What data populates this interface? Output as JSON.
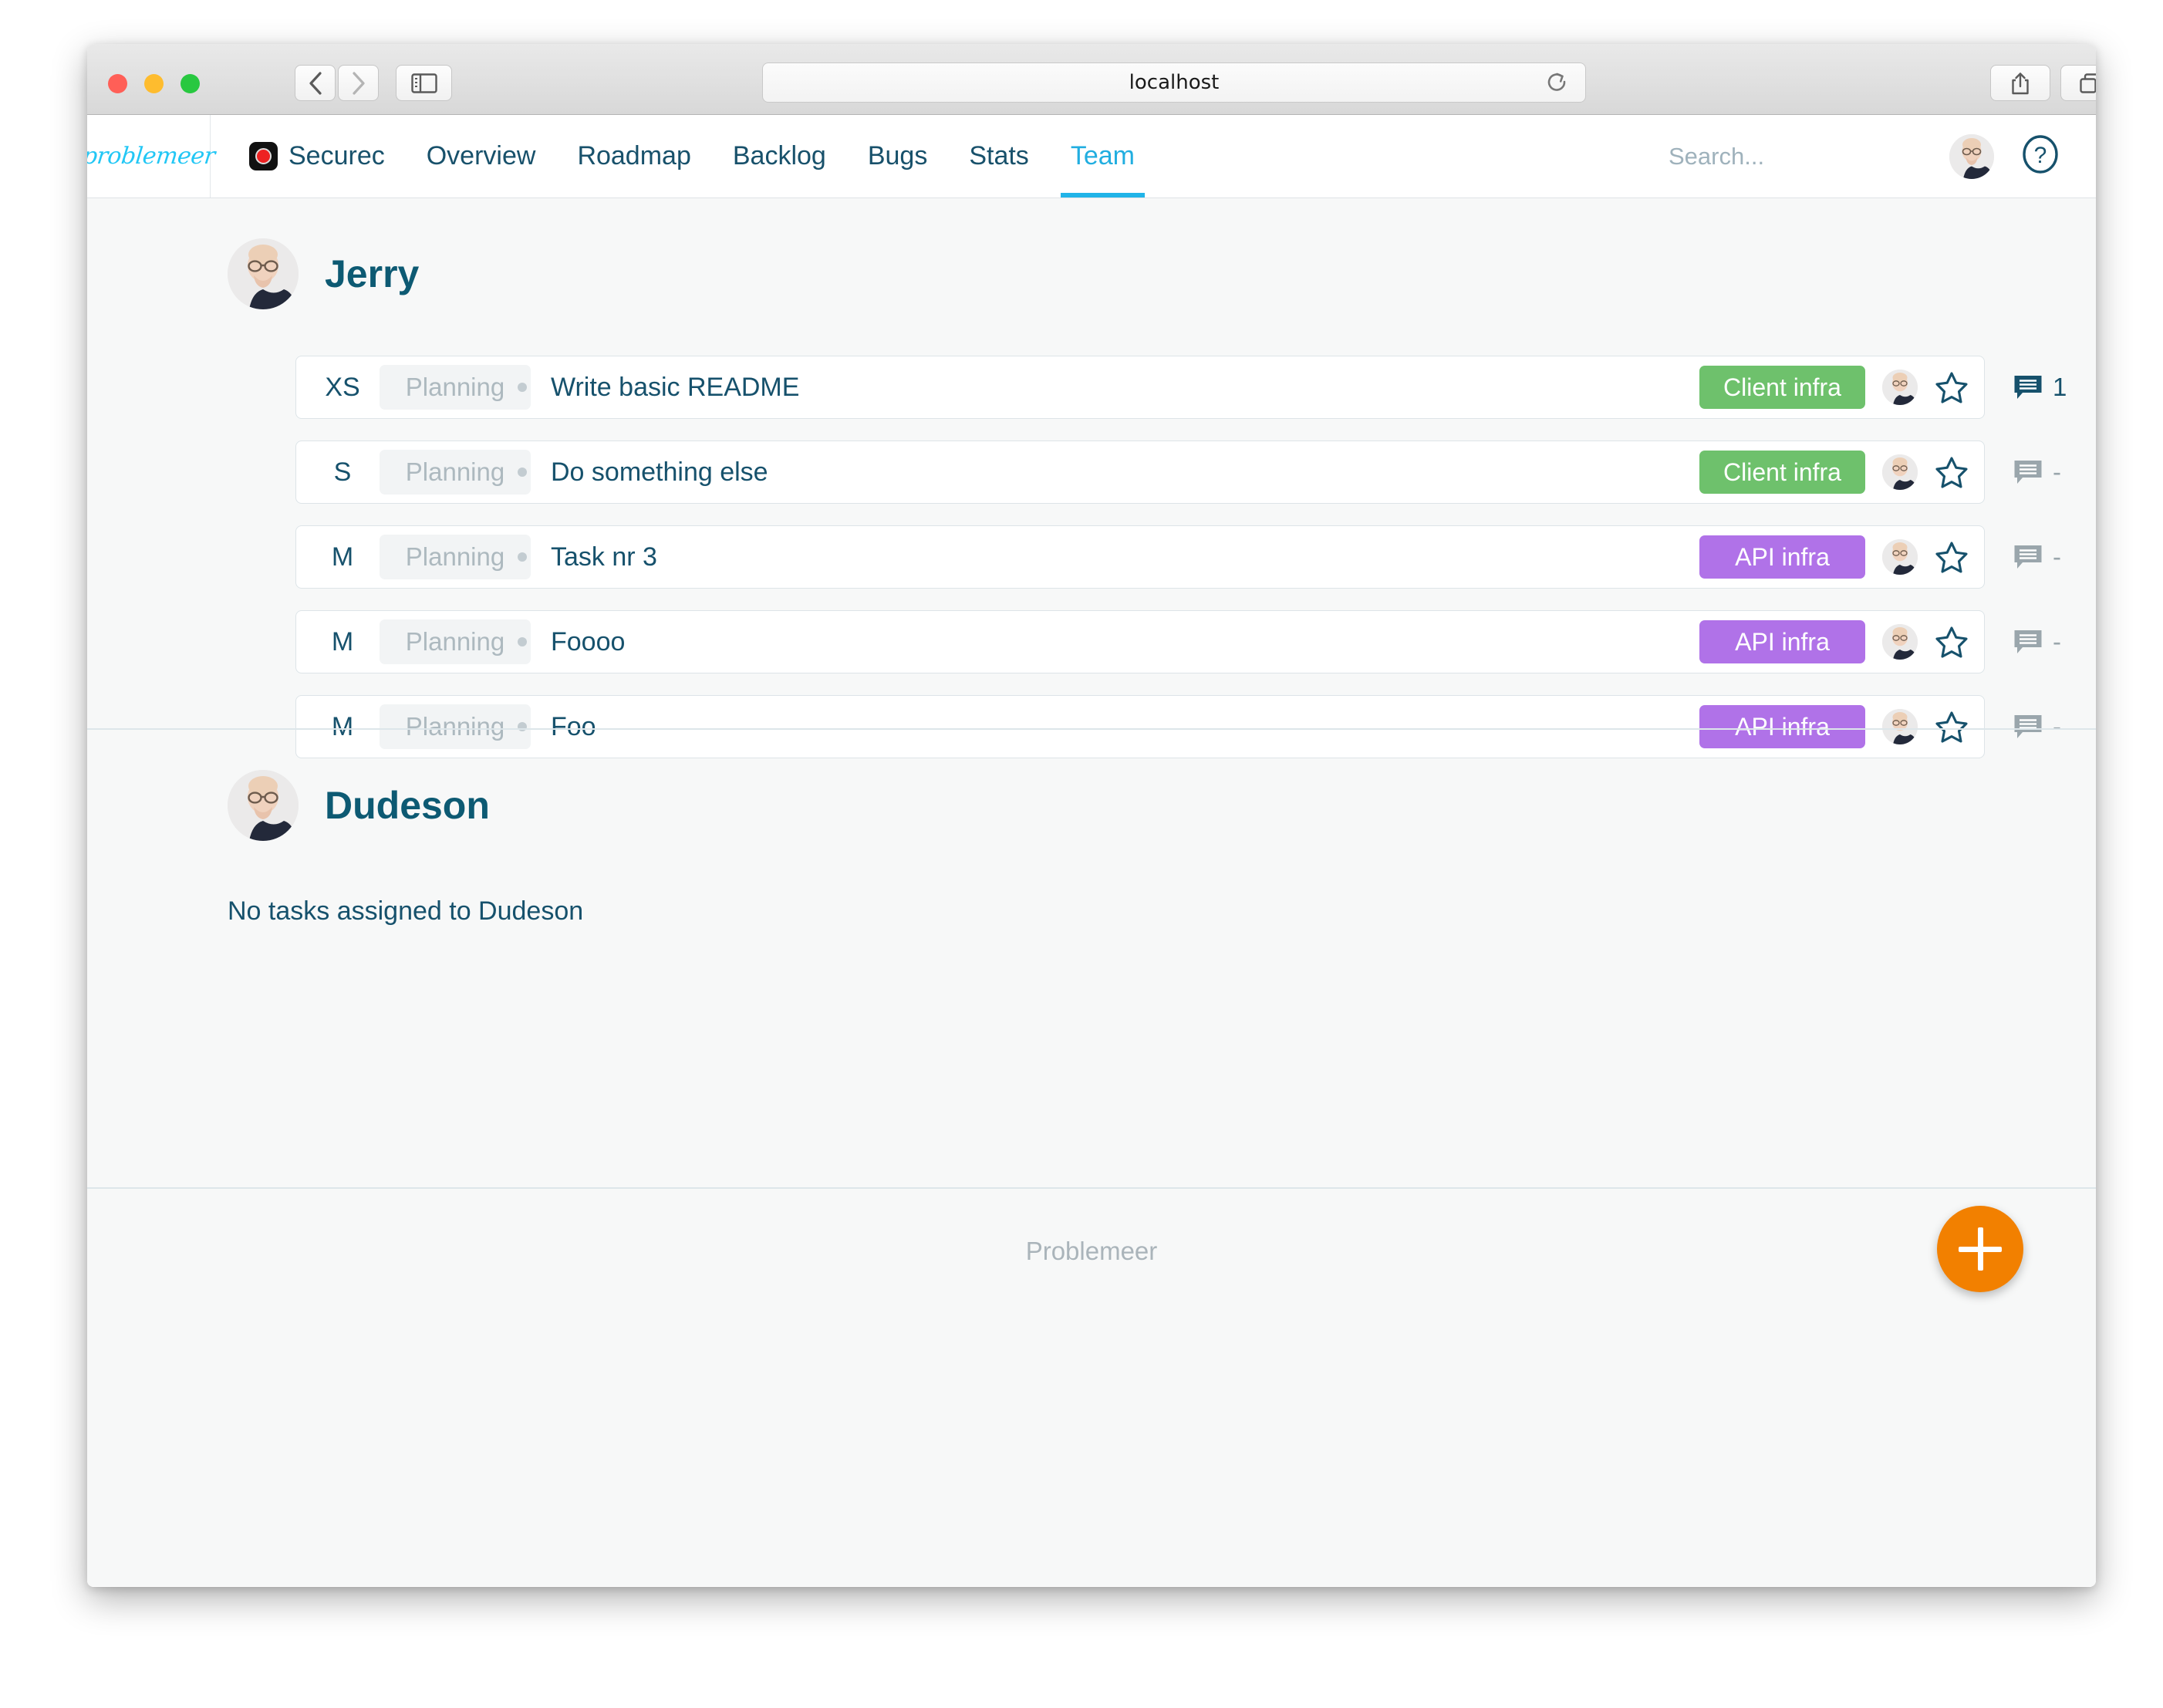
{
  "browser": {
    "url": "localhost",
    "icons": {
      "back": "back-chevron-icon",
      "forward": "forward-chevron-icon",
      "sidebar": "sidebar-toggle-icon",
      "reload": "reload-icon",
      "share": "share-icon",
      "tabs": "tab-overview-icon",
      "newtab": "new-tab-icon"
    }
  },
  "app": {
    "brand": "problemeer",
    "project": "Securec",
    "nav": [
      {
        "label": "Overview",
        "active": false
      },
      {
        "label": "Roadmap",
        "active": false
      },
      {
        "label": "Backlog",
        "active": false
      },
      {
        "label": "Bugs",
        "active": false
      },
      {
        "label": "Stats",
        "active": false
      },
      {
        "label": "Team",
        "active": true
      }
    ],
    "search_placeholder": "Search...",
    "search_value": "",
    "help_label": "?",
    "footer_text": "Problemeer",
    "fab_label": "+",
    "colors": {
      "accent": "#21b4e8",
      "brand_logo": "#22c7f5",
      "text_primary": "#16516c",
      "heading": "#0d5a73",
      "tag_client_infra": "#6ec16c",
      "tag_api_infra": "#b072e8",
      "fab": "#f28000"
    }
  },
  "sections": [
    {
      "person": "Jerry",
      "empty_message": null,
      "tasks": [
        {
          "size": "XS",
          "status": "Planning",
          "title": "Write basic README",
          "tag": "Client infra",
          "tag_color": "#6ec16c",
          "comments": "1",
          "has_comments": true
        },
        {
          "size": "S",
          "status": "Planning",
          "title": "Do something else",
          "tag": "Client infra",
          "tag_color": "#6ec16c",
          "comments": "-",
          "has_comments": false
        },
        {
          "size": "M",
          "status": "Planning",
          "title": "Task nr 3",
          "tag": "API infra",
          "tag_color": "#b072e8",
          "comments": "-",
          "has_comments": false
        },
        {
          "size": "M",
          "status": "Planning",
          "title": "Foooo",
          "tag": "API infra",
          "tag_color": "#b072e8",
          "comments": "-",
          "has_comments": false
        },
        {
          "size": "M",
          "status": "Planning",
          "title": "Foo",
          "tag": "API infra",
          "tag_color": "#b072e8",
          "comments": "-",
          "has_comments": false
        }
      ]
    },
    {
      "person": "Dudeson",
      "empty_message": "No tasks assigned to Dudeson",
      "tasks": []
    }
  ]
}
